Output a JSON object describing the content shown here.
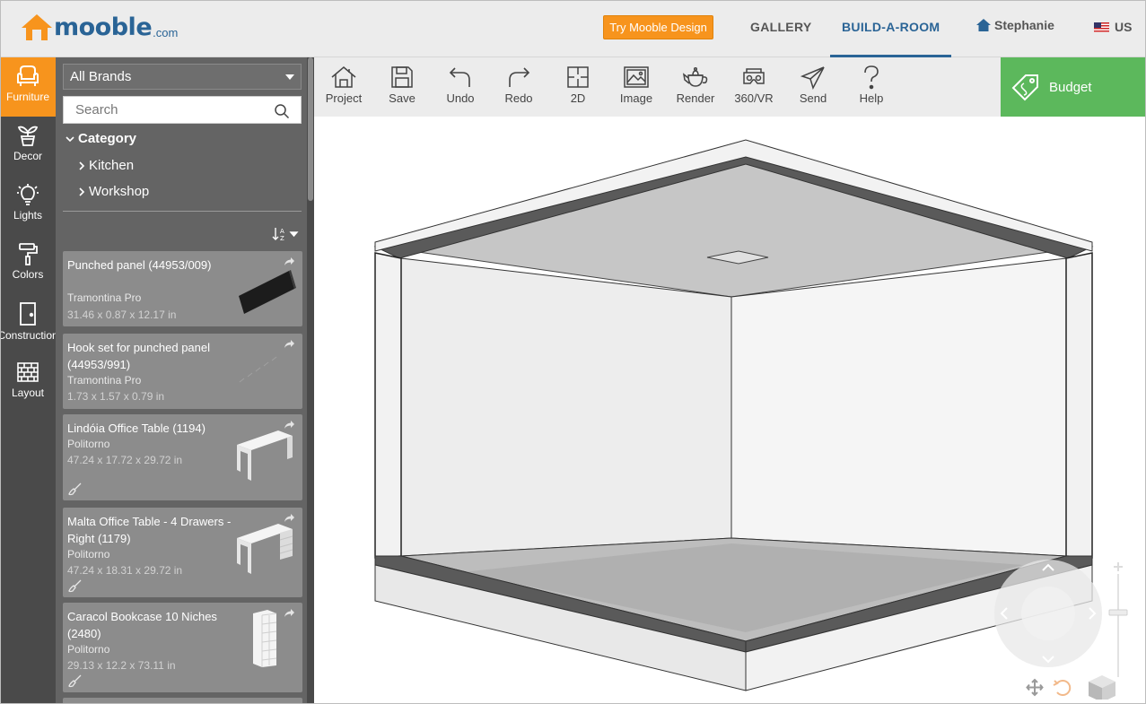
{
  "header": {
    "logo_text": "mooble",
    "logo_suffix": ".com",
    "try_button": "Try Mooble Design",
    "nav": {
      "gallery": "GALLERY",
      "build": "BUILD-A-ROOM",
      "user": "Stephanie",
      "lang": "US"
    }
  },
  "rail": [
    {
      "label": "Furniture",
      "icon": "armchair-icon",
      "active": true
    },
    {
      "label": "Decor",
      "icon": "plant-icon"
    },
    {
      "label": "Lights",
      "icon": "lightbulb-icon"
    },
    {
      "label": "Colors",
      "icon": "paint-roller-icon"
    },
    {
      "label": "Construction",
      "icon": "door-icon"
    },
    {
      "label": "Layout",
      "icon": "brick-wall-icon"
    }
  ],
  "catalog": {
    "brand_select": "All Brands",
    "search_placeholder": "Search",
    "category_heading": "Category",
    "categories": [
      "Kitchen",
      "Workshop"
    ],
    "items": [
      {
        "title": "Punched panel (44953/009)",
        "brand": "Tramontina Pro",
        "dims": "31.46 x 0.87 x 12.17 in"
      },
      {
        "title": "Hook set for punched panel (44953/991)",
        "brand": "Tramontina Pro",
        "dims": "1.73 x 1.57 x 0.79 in"
      },
      {
        "title": "Lindóia Office Table (1194)",
        "brand": "Politorno",
        "dims": "47.24 x 17.72 x 29.72 in"
      },
      {
        "title": "Malta Office Table - 4 Drawers - Right (1179)",
        "brand": "Politorno",
        "dims": "47.24 x 18.31 x 29.72 in"
      },
      {
        "title": "Caracol Bookcase 10 Niches (2480)",
        "brand": "Politorno",
        "dims": "29.13 x 12.2 x 73.11 in"
      }
    ]
  },
  "toolbar": {
    "tools": [
      {
        "label": "Project",
        "icon": "house-icon"
      },
      {
        "label": "Save",
        "icon": "floppy-icon"
      },
      {
        "label": "Undo",
        "icon": "undo-icon"
      },
      {
        "label": "Redo",
        "icon": "redo-icon"
      },
      {
        "label": "2D",
        "icon": "floorplan-icon"
      },
      {
        "label": "Image",
        "icon": "image-icon"
      },
      {
        "label": "Render",
        "icon": "teapot-icon"
      },
      {
        "label": "360/VR",
        "icon": "vr-headset-icon"
      },
      {
        "label": "Send",
        "icon": "paper-plane-icon"
      },
      {
        "label": "Help",
        "icon": "question-icon"
      }
    ],
    "budget": "Budget"
  },
  "colors": {
    "accent_orange": "#f7941d",
    "brand_blue": "#2a6496",
    "budget_green": "#5cb85c"
  }
}
